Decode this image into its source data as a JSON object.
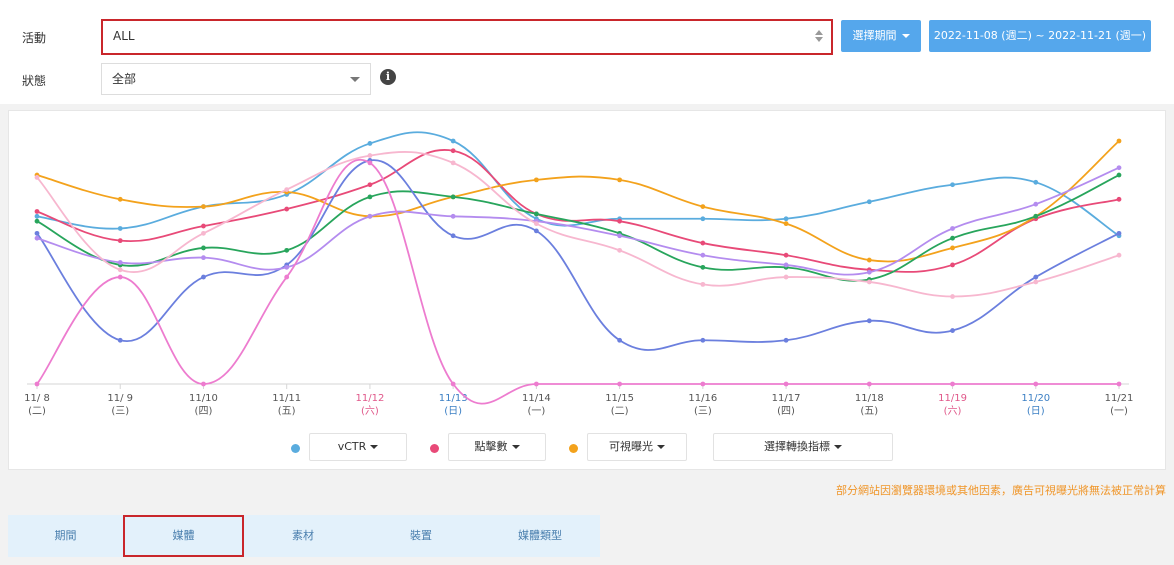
{
  "filters": {
    "campaign_label": "活動",
    "campaign_value": "ALL",
    "status_label": "狀態",
    "status_value": "全部",
    "period_button": "選擇期間",
    "date_range": "2022-11-08 (週二) ~ 2022-11-21 (週一)"
  },
  "icons": {
    "info": "info-icon",
    "campaign_select": "sort-arrows-icon",
    "status_select": "chevron-down-icon"
  },
  "legend": {
    "metric1": "vCTR",
    "metric2": "點擊數",
    "metric3": "可視曝光",
    "conversion": "選擇轉換指標"
  },
  "note": "部分網站因瀏覽器環境或其他因素，廣告可視曝光將無法被正常計算",
  "tabs": [
    "期間",
    "媒體",
    "素材",
    "裝置",
    "媒體類型"
  ],
  "active_tab": "媒體",
  "chart_data": {
    "type": "line",
    "title": "",
    "xlabel": "",
    "ylabel": "",
    "ylim": [
      0,
      100
    ],
    "grid": false,
    "legend_placement": "bottom",
    "categories": [
      "11/ 8",
      "11/ 9",
      "11/10",
      "11/11",
      "11/12",
      "11/13",
      "11/14",
      "11/15",
      "11/16",
      "11/17",
      "11/18",
      "11/19",
      "11/20",
      "11/21"
    ],
    "weekdays": [
      "(二)",
      "(三)",
      "(四)",
      "(五)",
      "(六)",
      "(日)",
      "(一)",
      "(二)",
      "(三)",
      "(四)",
      "(五)",
      "(六)",
      "(日)",
      "(一)"
    ],
    "weekday_colors": [
      "#555555",
      "#555555",
      "#555555",
      "#555555",
      "#e0588a",
      "#3b7fc4",
      "#555555",
      "#555555",
      "#555555",
      "#555555",
      "#555555",
      "#e0588a",
      "#3b7fc4",
      "#555555"
    ],
    "series": [
      {
        "color": "#5aacde",
        "values": [
          69,
          64,
          73,
          78,
          99,
          100,
          68,
          68,
          68,
          68,
          75,
          82,
          83,
          61
        ]
      },
      {
        "color": "#e84a78",
        "values": [
          71,
          59,
          65,
          72,
          82,
          96,
          70,
          67,
          58,
          53,
          47,
          49,
          68,
          76
        ]
      },
      {
        "color": "#f3a21c",
        "values": [
          86,
          76,
          73,
          79,
          69,
          77,
          84,
          84,
          73,
          66,
          51,
          56,
          69,
          100
        ]
      },
      {
        "color": "#28a55c",
        "values": [
          67,
          49,
          56,
          55,
          77,
          77,
          70,
          62,
          48,
          48,
          43,
          60,
          69,
          86
        ]
      },
      {
        "color": "#6b7fde",
        "values": [
          62,
          18,
          44,
          49,
          92,
          61,
          63,
          18,
          18,
          18,
          26,
          22,
          44,
          62
        ]
      },
      {
        "color": "#b48cef",
        "values": [
          60,
          50,
          52,
          48,
          69,
          69,
          67,
          61,
          53,
          49,
          46,
          64,
          74,
          89
        ]
      },
      {
        "color": "#f7b7cf",
        "values": [
          85,
          47,
          62,
          80,
          94,
          91,
          66,
          55,
          41,
          44,
          42,
          36,
          42,
          53
        ]
      },
      {
        "color": "#ed7ccf",
        "values": [
          0,
          44,
          0,
          44,
          91,
          0,
          0,
          0,
          0,
          0,
          0,
          0,
          0,
          0
        ]
      }
    ]
  }
}
